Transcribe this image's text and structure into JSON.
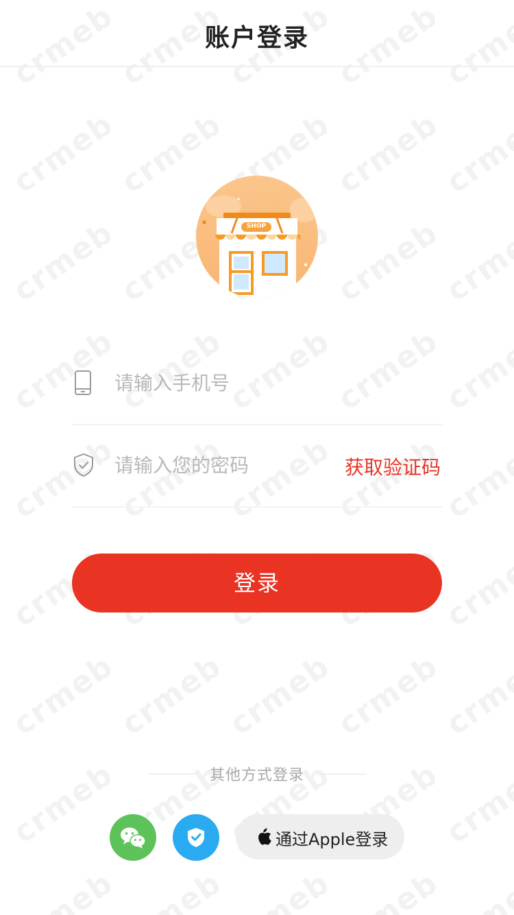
{
  "header": {
    "title": "账户登录"
  },
  "watermark": {
    "text": "crmeb"
  },
  "logo": {
    "shop_sign": "SHOP",
    "accent_color": "#f7a33d"
  },
  "form": {
    "phone": {
      "placeholder": "请输入手机号",
      "value": ""
    },
    "password": {
      "placeholder": "请输入您的密码",
      "value": ""
    },
    "get_code_label": "获取验证码"
  },
  "login_button": {
    "label": "登录",
    "color": "#e93323"
  },
  "other_login": {
    "title": "其他方式登录",
    "apple_label": "通过Apple登录",
    "wechat_color": "#5ec25a",
    "shield_color": "#2aaaf0"
  }
}
